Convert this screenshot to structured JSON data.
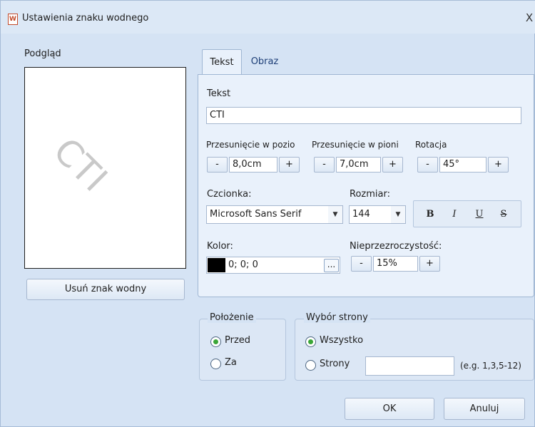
{
  "window": {
    "title": "Ustawienia znaku wodnego",
    "app_icon": "W",
    "close_glyph": "X"
  },
  "preview": {
    "label": "Podgląd",
    "watermark_text": "CTI"
  },
  "remove_button": "Usuń znak wodny",
  "tabs": [
    {
      "label": "Tekst",
      "active": true
    },
    {
      "label": "Obraz",
      "active": false
    }
  ],
  "text_tab": {
    "text_label": "Tekst",
    "text_value": "CTI",
    "offset_h": {
      "label": "Przesunięcie w pozio",
      "value": "8,0cm"
    },
    "offset_v": {
      "label": "Przesunięcie w pioni",
      "value": "7,0cm"
    },
    "rotation": {
      "label": "Rotacja",
      "value": "45°"
    },
    "minus": "-",
    "plus": "+",
    "font": {
      "label": "Czcionka:",
      "value": "Microsoft Sans Serif"
    },
    "size": {
      "label": "Rozmiar:",
      "value": "144"
    },
    "style_buttons": {
      "bold": "B",
      "italic": "I",
      "underline": "U",
      "strike": "S"
    },
    "color": {
      "label": "Kolor:",
      "value": "0; 0; 0",
      "swatch": "#000000",
      "browse": "..."
    },
    "opacity": {
      "label": "Nieprzezroczystość:",
      "value": "15%"
    }
  },
  "position_group": {
    "legend": "Położenie",
    "options": [
      {
        "label": "Przed",
        "checked": true
      },
      {
        "label": "Za",
        "checked": false
      }
    ]
  },
  "page_group": {
    "legend": "Wybór strony",
    "all_label": "Wszystko",
    "pages_label": "Strony",
    "pages_value": "",
    "hint": "(e.g. 1,3,5-12)"
  },
  "ok_button": "OK",
  "cancel_button": "Anuluj",
  "colors": {
    "background": "#d5e3f4",
    "panel": "#e9f1fb",
    "radio_checked": "#3aa637",
    "border": "#a6b7cf"
  }
}
